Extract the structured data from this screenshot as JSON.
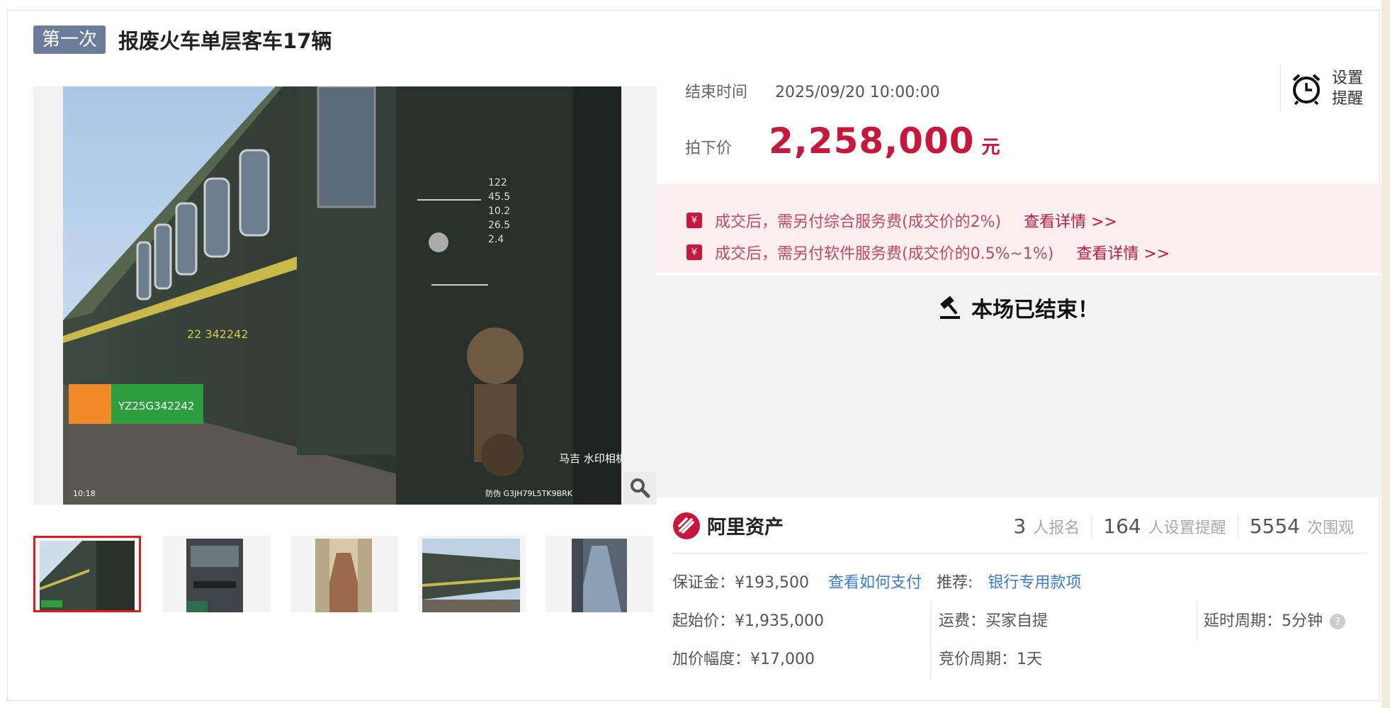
{
  "header": {
    "badge": "第一次",
    "title": "报废火车单层客车17辆"
  },
  "gallery": {
    "main_overlay": {
      "plate": "YZ25G342242",
      "time": "10:18",
      "watermark": "马吉\n水印相机",
      "code": "防伪 G3JH79L5TK9BRK",
      "side_text": "22 342242"
    },
    "thumbnails": [
      {
        "label": "train exterior with door",
        "active": true
      },
      {
        "label": "bunk interior"
      },
      {
        "label": "corridor interior"
      },
      {
        "label": "train side view"
      },
      {
        "label": "aisle interior"
      }
    ],
    "zoom_icon": "magnifier-icon"
  },
  "auction": {
    "end_label": "结束时间",
    "end_time": "2025/09/20 10:00:00",
    "remind_label_1": "设置",
    "remind_label_2": "提醒",
    "price_label": "拍下价",
    "price_value": "2,258,000",
    "price_unit": "元",
    "fees": [
      {
        "text": "成交后，需另付综合服务费(成交价的2%)",
        "link": "查看详情 >>"
      },
      {
        "text": "成交后，需另付软件服务费(成交价的0.5%~1%)",
        "link": "查看详情 >>"
      }
    ],
    "fee_icon_glyph": "¥",
    "ended_text": "本场已结束！"
  },
  "brand": {
    "name": "阿里资产"
  },
  "stats": [
    {
      "num": "3",
      "text": "人报名"
    },
    {
      "num": "164",
      "text": "人设置提醒"
    },
    {
      "num": "5554",
      "text": "次围观"
    }
  ],
  "details": {
    "deposit": "保证金：¥193,500",
    "deposit_link": "查看如何支付",
    "recommend_label": "推荐:",
    "recommend_link": "银行专用款项",
    "start_price": "起始价：¥1,935,000",
    "shipping": "运费：买家自提",
    "delay": "延时周期：5分钟",
    "increment": "加价幅度：¥17,000",
    "bid_period": "竞价周期：1天",
    "help_glyph": "?"
  },
  "colors": {
    "accent": "#c8173c",
    "badge": "#6b7b9a",
    "link": "#3a7bd5",
    "fee_bg": "#fdeef0"
  }
}
